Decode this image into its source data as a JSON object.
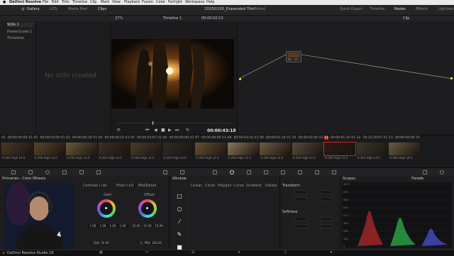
{
  "menubar": {
    "app": "DaVinci Resolve",
    "items": [
      "File",
      "Edit",
      "Trim",
      "Timeline",
      "Clip",
      "Mark",
      "View",
      "Playback",
      "Fusion",
      "Color",
      "Fairlight",
      "Workspace",
      "Help"
    ]
  },
  "toolbar": {
    "gallery": "Gallery",
    "luts": "LUTs",
    "media_pool": "Media Pool",
    "clips": "Clips",
    "project_title": "20250130_Expanded Trim",
    "edited": "Edited",
    "quick_export": "Quick Export",
    "timeline": "Timeline",
    "nodes": "Nodes",
    "effects": "Effects",
    "lightbox": "Lightbox"
  },
  "subbar": {
    "zoom": "27%",
    "timeline_name": "Timeline 1",
    "timecode": "00:00:02:13",
    "clip": "Clip"
  },
  "stills": {
    "header": "Stills 1",
    "items": [
      "PowerGrade 1",
      "Timelines"
    ],
    "empty": "No stills created"
  },
  "viewer": {
    "timecode": "00:00:43:18"
  },
  "node": {
    "label": "01",
    "sub": "H"
  },
  "clips": [
    {
      "num": "01",
      "tc": "00:00:00:00",
      "v": "V1",
      "codec": "H.264 High L4.0"
    },
    {
      "num": "02",
      "tc": "00:00:03:09",
      "v": "V1",
      "codec": "H.264 High L4.0"
    },
    {
      "num": "03",
      "tc": "00:00:00:18",
      "v": "V1",
      "codec": "H.264 High L4.0"
    },
    {
      "num": "04",
      "tc": "00:00:00:10",
      "v": "V1",
      "codec": "H.264 High L4.0"
    },
    {
      "num": "05",
      "tc": "00:00:04:07",
      "v": "V1",
      "codec": "H.264 High L4.0"
    },
    {
      "num": "06",
      "tc": "00:00:00:00",
      "v": "V1",
      "codec": "H.264 High L4.0"
    },
    {
      "num": "07",
      "tc": "00:00:00:00",
      "v": "V1",
      "codec": "H.264 High L4.0"
    },
    {
      "num": "08",
      "tc": "00:00:03:16",
      "v": "V1",
      "codec": "H.264 High L4.0"
    },
    {
      "num": "09",
      "tc": "00:00:01:14",
      "v": "V1",
      "codec": "H.264 High L4.0"
    },
    {
      "num": "10",
      "tc": "00:00:02:04",
      "v": "V1",
      "codec": "H.264 High L4.0"
    },
    {
      "num": "11",
      "tc": "00:00:01:10",
      "v": "V1",
      "codec": "H.264 High L5.2"
    },
    {
      "num": "12",
      "tc": "20:12:20:07",
      "v": "V1",
      "codec": "H.264 High L4.0"
    },
    {
      "num": "13",
      "tc": "00:00:00:00",
      "v": "V1",
      "codec": "H.264 High L4.0"
    }
  ],
  "primaries": {
    "title": "Primaries - Color Wheels",
    "contrast_label": "Contrast",
    "contrast": "1.000",
    "pivot_label": "Pivot",
    "pivot": "0.435",
    "middetail_label": "Mid/Detail",
    "gain_label": "Gain",
    "offset_label": "Offset",
    "gain_values": [
      "1.00",
      "1.00",
      "1.00",
      "1.00"
    ],
    "offset_values": [
      "25.00",
      "25.00",
      "25.00"
    ],
    "sat_label": "Sat",
    "sat": "50.00",
    "lum_mix_label": "L. Mix",
    "lum_mix": "100.00"
  },
  "window": {
    "title": "Window",
    "tools": [
      "Linear",
      "Circle",
      "Polygon",
      "Curve",
      "Gradient"
    ],
    "delete": "Delete"
  },
  "transform": {
    "title": "Transform",
    "softness": "Softness",
    "rows": [
      "Size",
      "Pan",
      "Tilt",
      "Rotate",
      "Soft 1",
      "Soft 2",
      "Soft 3",
      "Soft 4"
    ]
  },
  "scopes": {
    "title": "Scopes",
    "mode": "Parade",
    "scale": [
      "1023",
      "896",
      "768",
      "640",
      "512",
      "384",
      "256",
      "128",
      "0"
    ]
  },
  "statusbar": {
    "app": "DaVinci Resolve Studio 19"
  },
  "colors": {
    "accent": "#c8282d",
    "node_line": "#b5b5b5",
    "node_in": "#c6e23a"
  }
}
